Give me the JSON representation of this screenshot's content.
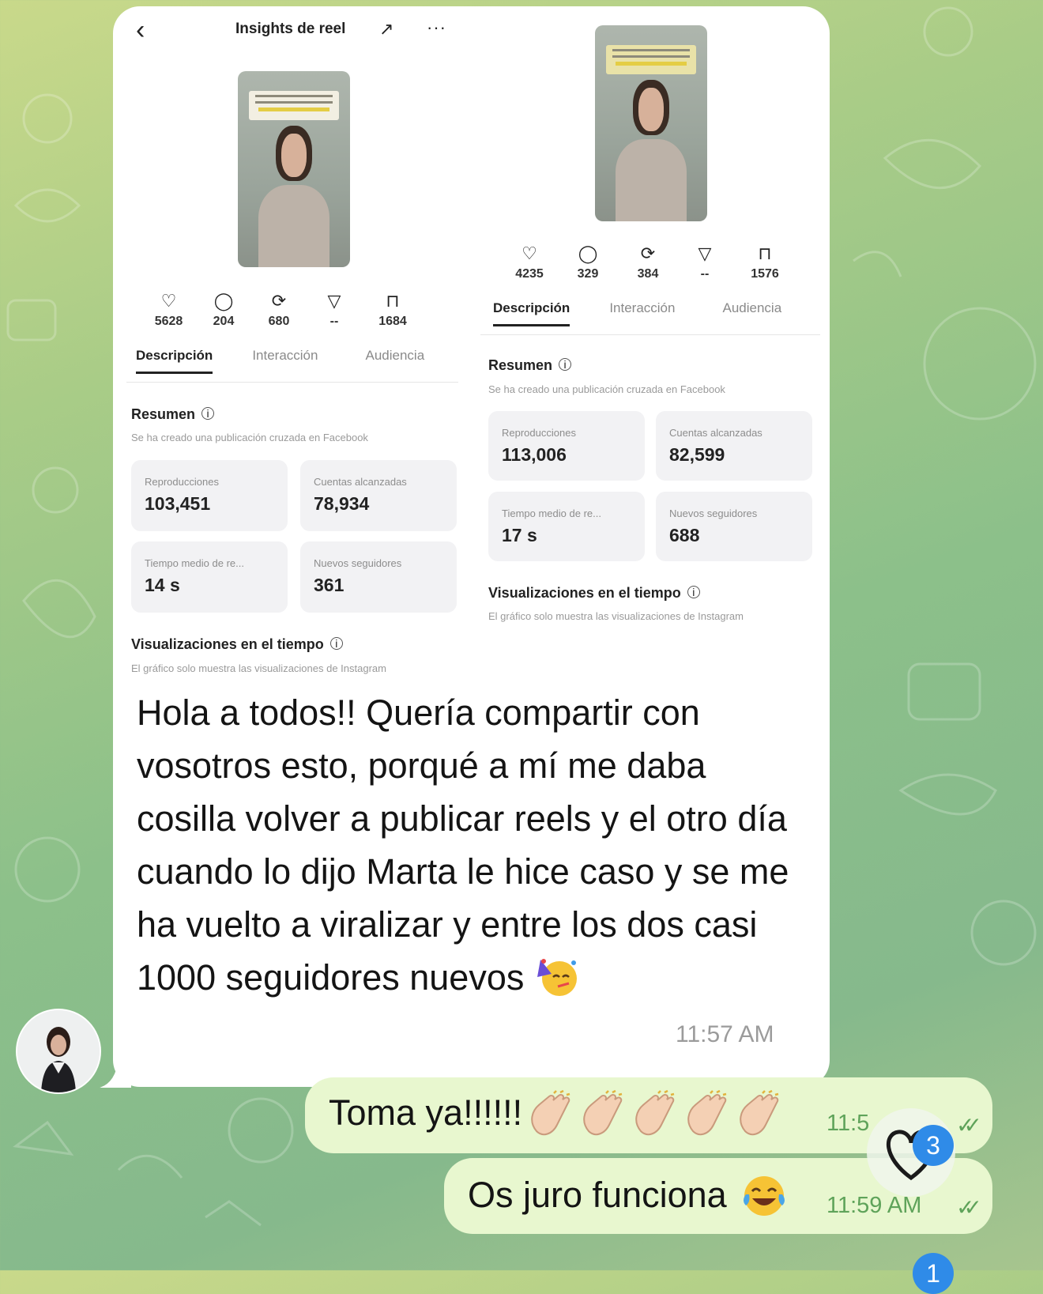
{
  "left_screenshot": {
    "title": "Insights de reel",
    "back_icon": "chevron-left-icon",
    "trend_icon": "trending-up-icon",
    "more_icon": "more-horizontal-icon",
    "stats": [
      {
        "icon": "heart-icon",
        "value": "5628"
      },
      {
        "icon": "comment-icon",
        "value": "204"
      },
      {
        "icon": "repost-icon",
        "value": "680"
      },
      {
        "icon": "share-icon",
        "value": "--"
      },
      {
        "icon": "bookmark-icon",
        "value": "1684"
      }
    ],
    "tabs": [
      "Descripción",
      "Interacción",
      "Audiencia"
    ],
    "summary_title": "Resumen",
    "summary_sub": "Se ha creado una publicación cruzada en Facebook",
    "cards": [
      {
        "label": "Reproducciones",
        "value": "103,451"
      },
      {
        "label": "Cuentas alcanzadas",
        "value": "78,934"
      },
      {
        "label": "Tiempo medio de re...",
        "value": "14 s"
      },
      {
        "label": "Nuevos seguidores",
        "value": "361"
      }
    ],
    "views_title": "Visualizaciones en el tiempo",
    "views_sub": "El gráfico solo muestra las visualizaciones de Instagram"
  },
  "right_screenshot": {
    "stats": [
      {
        "icon": "heart-icon",
        "value": "4235"
      },
      {
        "icon": "comment-icon",
        "value": "329"
      },
      {
        "icon": "repost-icon",
        "value": "384"
      },
      {
        "icon": "share-icon",
        "value": "--"
      },
      {
        "icon": "bookmark-icon",
        "value": "1576"
      }
    ],
    "tabs": [
      "Descripción",
      "Interacción",
      "Audiencia"
    ],
    "summary_title": "Resumen",
    "summary_sub": "Se ha creado una publicación cruzada en Facebook",
    "cards": [
      {
        "label": "Reproducciones",
        "value": "113,006"
      },
      {
        "label": "Cuentas alcanzadas",
        "value": "82,599"
      },
      {
        "label": "Tiempo medio de re...",
        "value": "17 s"
      },
      {
        "label": "Nuevos seguidores",
        "value": "688"
      }
    ],
    "views_title": "Visualizaciones en el tiempo",
    "views_sub": "El gráfico solo muestra las visualizaciones de Instagram"
  },
  "incoming_message": {
    "text": "Hola a todos!! Quería compartir con vosotros esto, porqué a mí me daba cosilla volver a publicar reels y el otro día cuando lo dijo Marta le hice caso y se me ha vuelto a viralizar y entre los dos casi 1000 seguidores nuevos",
    "emoji": "party-face-emoji",
    "time": "11:57 AM"
  },
  "outgoing_messages": [
    {
      "text": "Toma ya!!!!!!",
      "emoji": "clapping-hands-emoji",
      "emoji_count": 5,
      "time": "11:5",
      "status": "read-double-check"
    },
    {
      "text": "Os juro funciona",
      "emoji": "tears-of-joy-emoji",
      "time": "11:59 AM",
      "status": "read-double-check"
    }
  ],
  "reaction": {
    "icon": "heart-outline-icon",
    "badge_top": "3",
    "badge_bottom": "1"
  },
  "colors": {
    "incoming_bubble": "#ffffff",
    "outgoing_bubble": "#e8f7cf",
    "check_green": "#5fa35a",
    "badge_blue": "#2f8be8"
  }
}
